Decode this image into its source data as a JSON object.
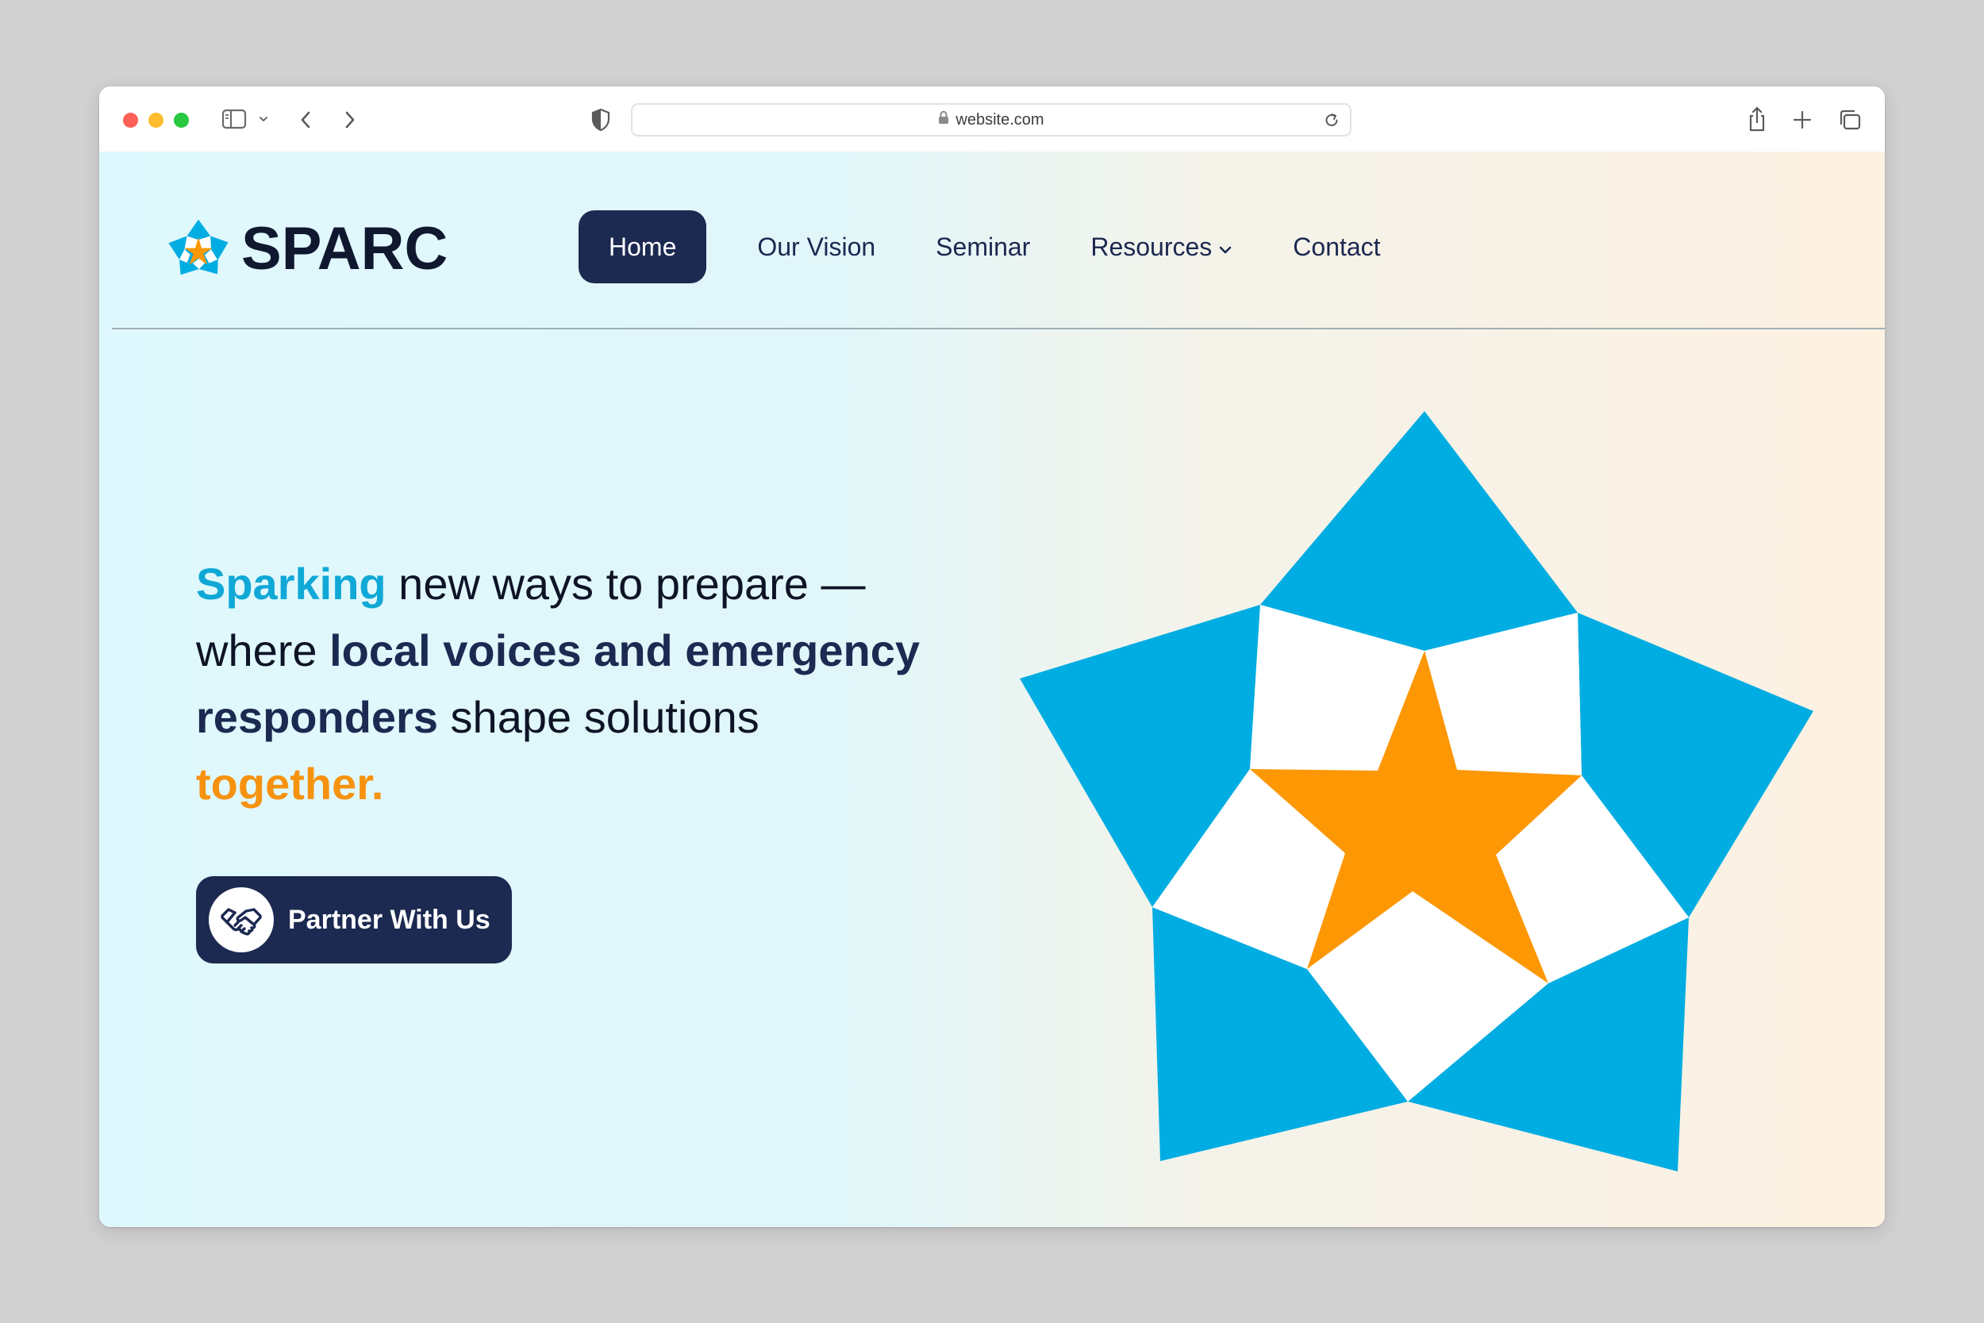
{
  "browser": {
    "url": "website.com",
    "icons": {
      "sidebar": "sidebar-icon",
      "back": "chevron-left-icon",
      "forward": "chevron-right-icon",
      "privacy": "shield-icon",
      "lock": "lock-icon",
      "reload": "reload-icon",
      "share": "share-icon",
      "new_tab": "plus-icon",
      "tabs": "tabs-overview-icon"
    }
  },
  "site": {
    "brand": "SPARC",
    "nav": [
      {
        "label": "Home",
        "active": true
      },
      {
        "label": "Our Vision"
      },
      {
        "label": "Seminar"
      },
      {
        "label": "Resources",
        "has_dropdown": true
      },
      {
        "label": "Contact"
      }
    ],
    "headline": {
      "p1": "Sparking",
      "p2": " new ways to prepare — where ",
      "p3": "local voices and emergency responders",
      "p4": " shape solutions ",
      "p5": "together."
    },
    "cta": {
      "label": "Partner With Us",
      "icon": "handshake-icon"
    }
  },
  "colors": {
    "navy": "#1c2951",
    "sky": "#00ade2",
    "orange": "#fd9703",
    "white": "#ffffff"
  }
}
